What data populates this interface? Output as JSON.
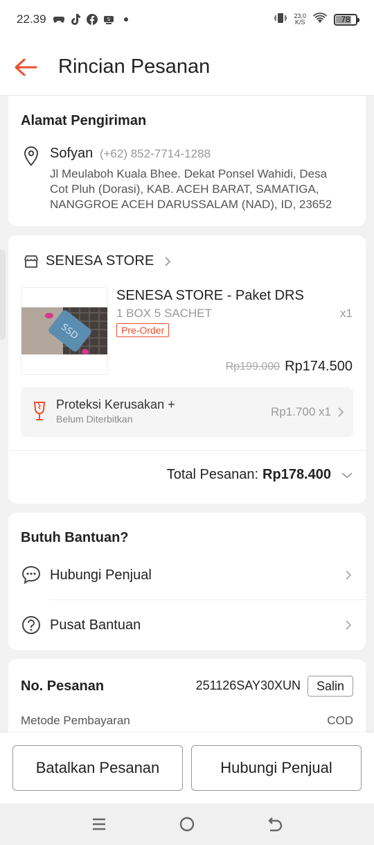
{
  "status_bar": {
    "time": "22.39",
    "net_speed_value": "23,0",
    "net_speed_unit": "K/S",
    "battery": "78",
    "battery_level": 0.78
  },
  "header": {
    "title": "Rincian Pesanan"
  },
  "address": {
    "title": "Alamat Pengiriman",
    "name": "Sofyan",
    "phone": "(+62) 852-7714-1288",
    "lines": [
      "Jl Meulaboh Kuala Bhee. Dekat Ponsel Wahidi, Desa",
      "Cot Pluh (Dorasi), KAB. ACEH BARAT, SAMATIGA,",
      "NANGGROE ACEH DARUSSALAM (NAD), ID, 23652"
    ]
  },
  "store": {
    "name": "SENESA STORE",
    "product": {
      "title": "SENESA STORE - Paket DRS",
      "variant": "1 BOX 5 SACHET",
      "qty": "x1",
      "badge": "Pre-Order",
      "price_old": "Rp199.000",
      "price_new": "Rp174.500",
      "image_label": "SSD"
    },
    "protection": {
      "name": "Proteksi Kerusakan +",
      "status": "Belum Diterbitkan",
      "price": "Rp1.700 x1"
    },
    "total_label": "Total Pesanan:",
    "total_value": "Rp178.400"
  },
  "help": {
    "title": "Butuh Bantuan?",
    "items": [
      {
        "label": "Hubungi Penjual",
        "icon": "chat-icon"
      },
      {
        "label": "Pusat Bantuan",
        "icon": "help-circle-icon"
      }
    ]
  },
  "order": {
    "no_label": "No. Pesanan",
    "no_value": "251126SAY30XUN",
    "copy_label": "Salin",
    "payment_label": "Metode Pembayaran",
    "payment_value": "COD"
  },
  "actions": {
    "cancel_label": "Batalkan Pesanan",
    "chat_label": "Hubungi Penjual"
  },
  "colors": {
    "accent": "#ee4d2d",
    "background": "#f2f2f2"
  }
}
